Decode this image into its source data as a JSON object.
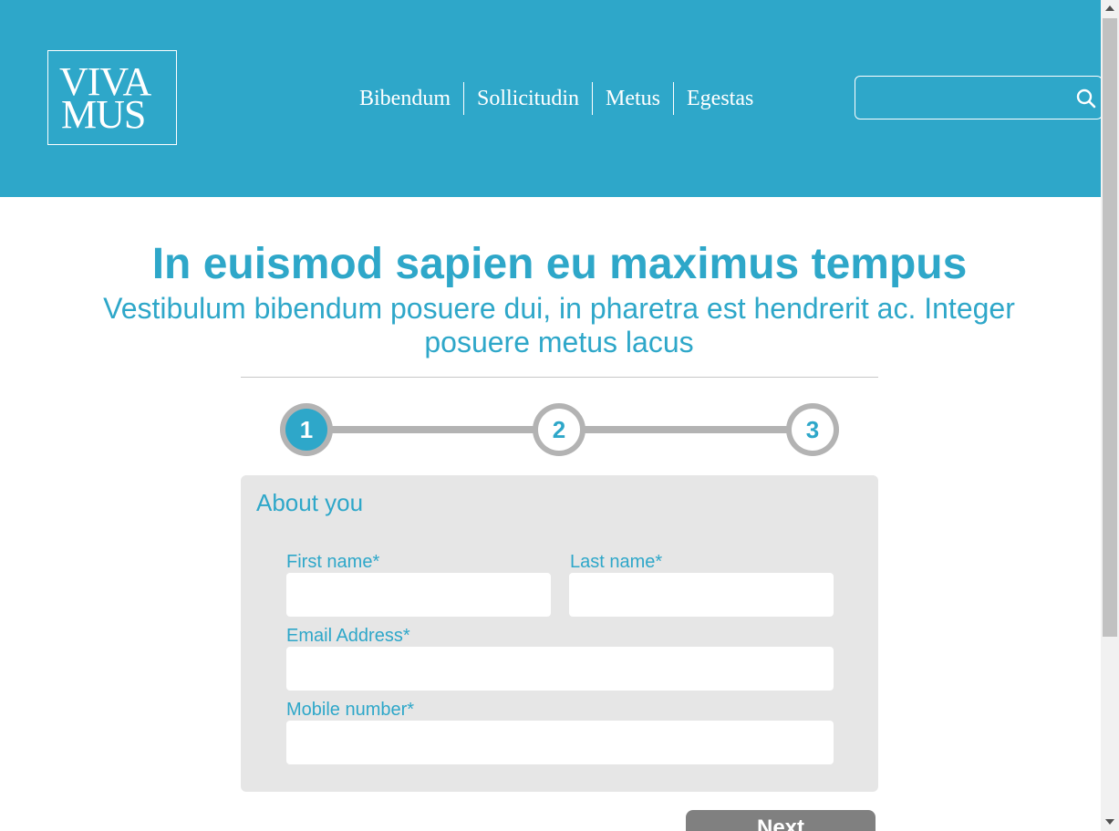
{
  "header": {
    "logo": {
      "line1": "VIVA",
      "line2": "MUS"
    },
    "nav": [
      "Bibendum",
      "Sollicitudin",
      "Metus",
      "Egestas"
    ],
    "search": {
      "placeholder": "",
      "icon": "search-icon"
    }
  },
  "main": {
    "title": "In euismod sapien eu maximus tempus",
    "subtitle": "Vestibulum bibendum posuere dui, in pharetra est hendrerit ac. Integer posuere metus lacus",
    "steps": [
      "1",
      "2",
      "3"
    ],
    "active_step": 1,
    "form": {
      "title": "About you",
      "first_name": {
        "label": "First name*",
        "value": ""
      },
      "last_name": {
        "label": "Last name*",
        "value": ""
      },
      "email": {
        "label": "Email Address*",
        "value": ""
      },
      "mobile": {
        "label": "Mobile number*",
        "value": ""
      }
    },
    "next_label": "Next"
  },
  "colors": {
    "accent": "#2ea7c9",
    "card": "#e6e6e6",
    "step_track": "#b3b3b3",
    "button": "#808080"
  }
}
